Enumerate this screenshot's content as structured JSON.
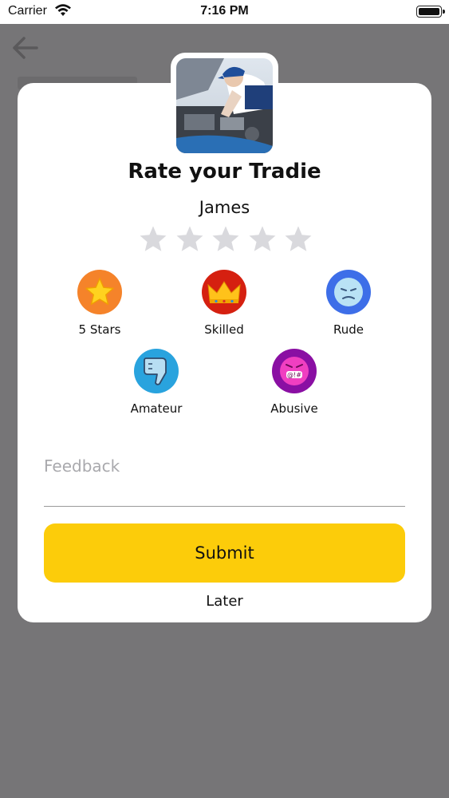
{
  "status_bar": {
    "carrier": "Carrier",
    "time": "7:16 PM"
  },
  "dialog": {
    "title": "Rate your Tradie",
    "tradie_name": "James",
    "rating": {
      "max": 5,
      "selected": 0
    },
    "badges": [
      {
        "label": "5 Stars",
        "icon": "star-badge-icon",
        "color": "#f5832a"
      },
      {
        "label": "Skilled",
        "icon": "crown-badge-icon",
        "color": "#d52010"
      },
      {
        "label": "Rude",
        "icon": "frowning-face-icon",
        "color": "#3d6ee8"
      },
      {
        "label": "Amateur",
        "icon": "thumbs-down-icon",
        "color": "#29a3de"
      },
      {
        "label": "Abusive",
        "icon": "swearing-face-icon",
        "color": "#8a0fa3"
      }
    ],
    "feedback": {
      "placeholder": "Feedback",
      "value": ""
    },
    "submit_label": "Submit",
    "later_label": "Later"
  },
  "colors": {
    "overlay": "#767577",
    "accent": "#fccc0a",
    "star_empty": "#d9d9dd"
  }
}
